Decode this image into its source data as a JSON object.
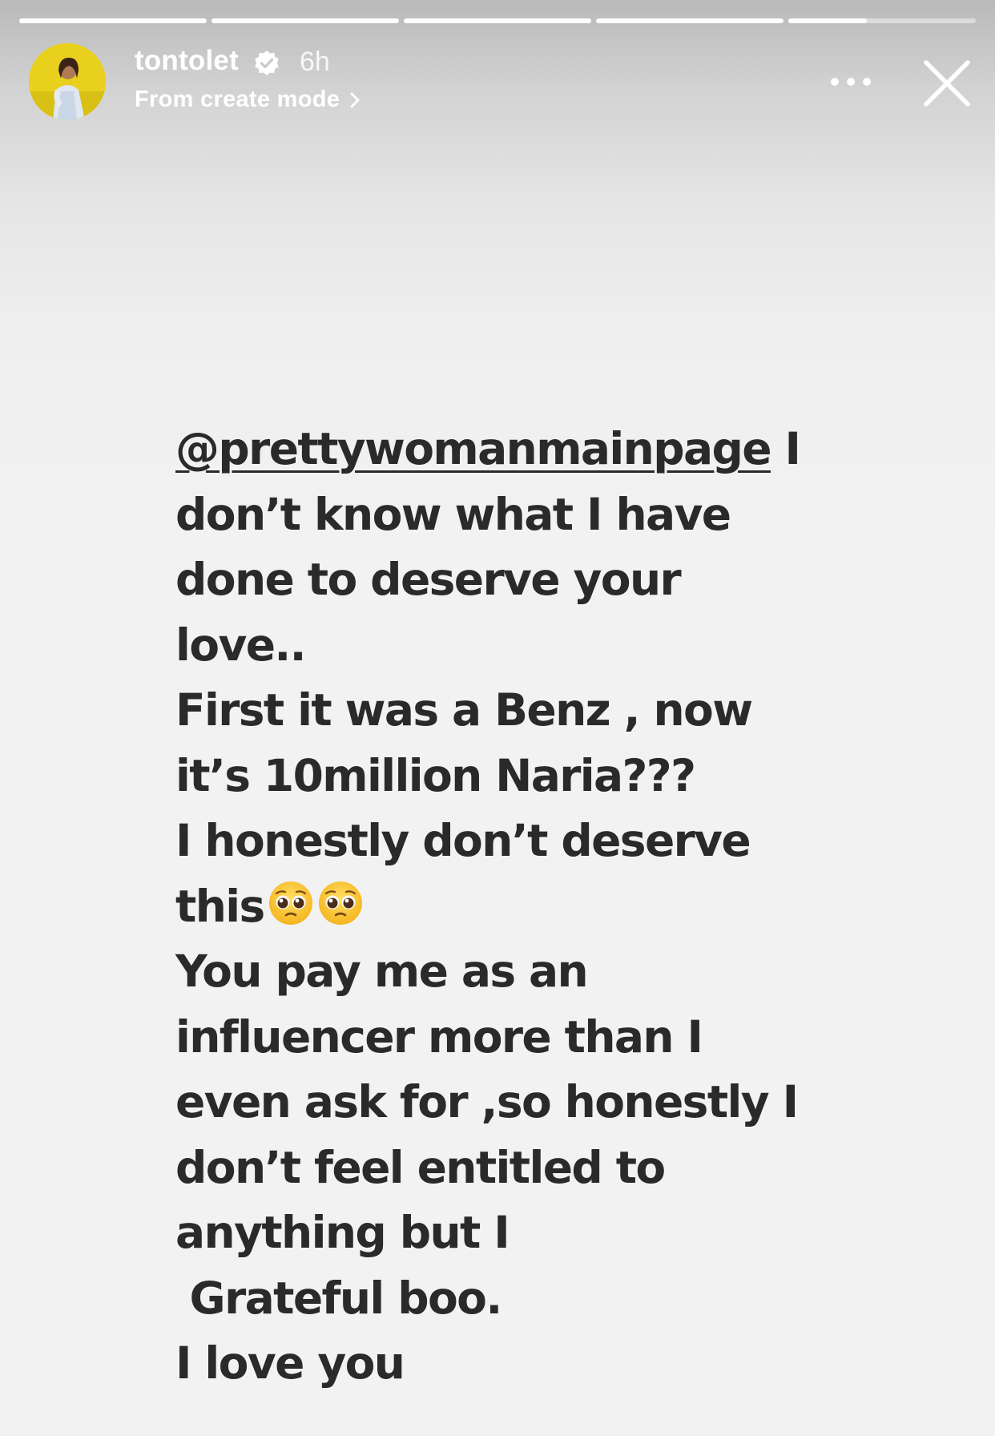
{
  "story": {
    "progress": [
      1,
      1,
      1,
      1,
      0.42
    ],
    "header": {
      "username": "tontolet",
      "time": "6h",
      "subline": "From create mode"
    },
    "icons": {
      "verified": "verified-badge-icon",
      "more": "more-options-icon",
      "close": "close-icon",
      "chevron": "chevron-right-icon",
      "emoji": "pleading-face-emoji"
    },
    "text": {
      "mention": "@prettywomanmainpage",
      "line1_rest": " I",
      "line2": "don’t know what I have",
      "line3": "done to deserve your",
      "line4": "love..",
      "line5": "First it was a Benz , now",
      "line6": "it’s 10million Naria???",
      "line7": "I honestly don’t deserve",
      "line8": "this",
      "line9": "You pay me as an",
      "line10": "influencer more than I",
      "line11": "even ask for ,so honestly I",
      "line12": "don’t feel entitled to",
      "line13": "anything but I",
      "line14": " Grateful boo.",
      "line15": "I love you"
    },
    "colors": {
      "text": "#2a2a2a",
      "background": "#f2f2f2",
      "avatar_bg": "#e9d21a"
    }
  }
}
